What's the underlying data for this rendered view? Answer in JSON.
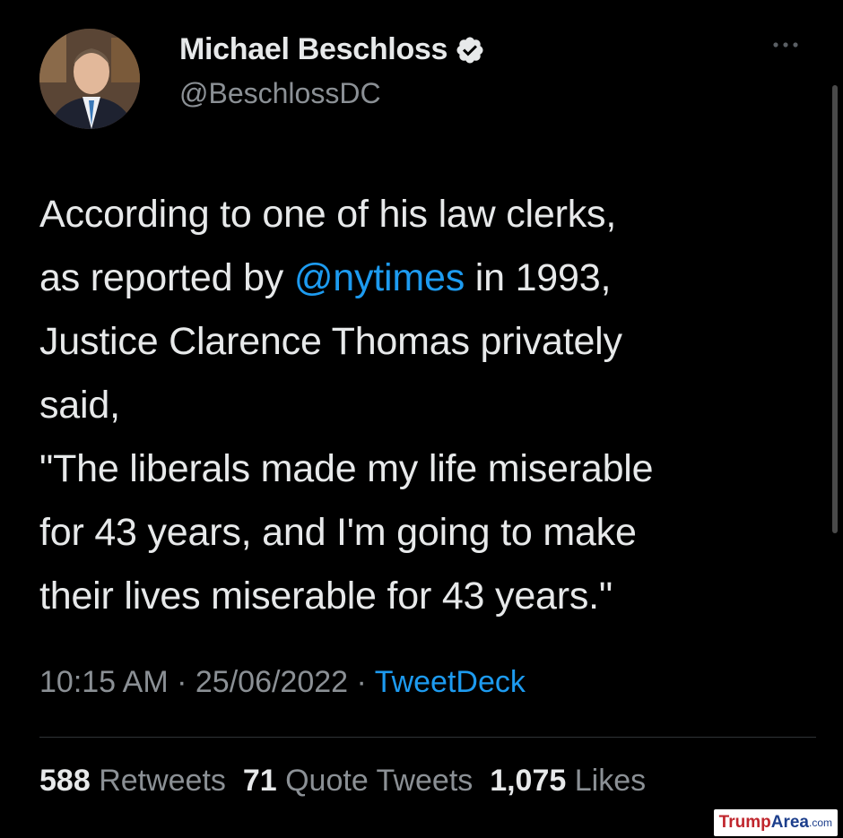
{
  "author": {
    "name": "Michael Beschloss",
    "handle": "@BeschlossDC"
  },
  "tweet": {
    "lines": [
      [
        "According to one of his law clerks,"
      ],
      [
        "as reported by ",
        "@nytimes",
        " in 1993,"
      ],
      [
        "Justice Clarence Thomas privately"
      ],
      [
        "said,"
      ],
      [
        "\"The liberals made my life miserable"
      ],
      [
        "for 43 years, and I'm going to make"
      ],
      [
        "their lives miserable for 43 years.\""
      ]
    ],
    "mention": "@nytimes"
  },
  "meta": {
    "time": "10:15 AM",
    "date": "25/06/2022",
    "separator": "·",
    "source": "TweetDeck"
  },
  "stats": {
    "retweets": "588",
    "retweets_label": "Retweets",
    "quotes": "71",
    "quotes_label": "Quote Tweets",
    "likes": "1,075",
    "likes_label": "Likes"
  },
  "watermark": {
    "brand_part1": "Trump",
    "brand_part2": "Area",
    "brand_part3": ".com"
  },
  "colors": {
    "background": "#000000",
    "text": "#e7e9ea",
    "secondary": "#8b9095",
    "accent": "#1d9bf0"
  },
  "icons": {
    "verified": "verified-badge-icon",
    "more": "more-options-icon"
  }
}
